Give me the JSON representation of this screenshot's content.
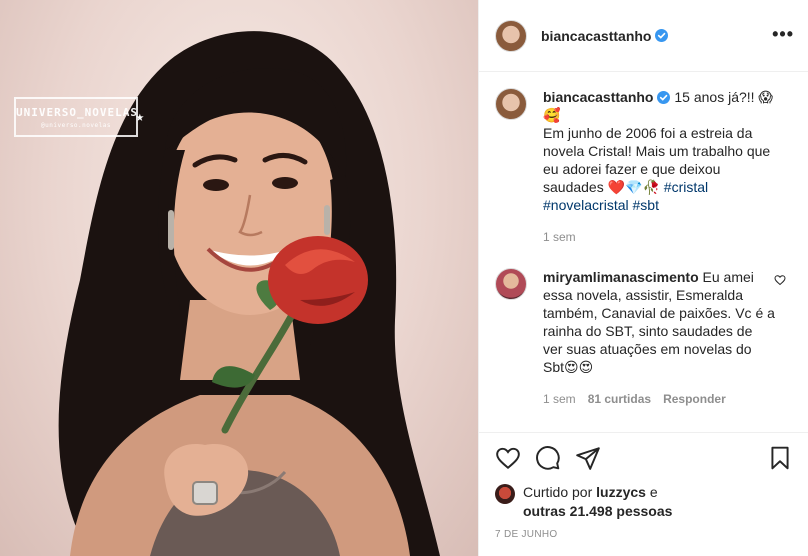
{
  "header": {
    "username": "biancacasttanho",
    "more_label": "•••"
  },
  "photo": {
    "watermark": "UNIVERSO_NOVELAS",
    "watermark_sub": "@universo.novelas"
  },
  "caption": {
    "username": "biancacasttanho",
    "text_line1": " 15 anos já?!! 😱🥰",
    "text_body": "Em junho de 2006 foi a estreia da novela Cristal! Mais um trabalho que eu adorei fazer e que deixou saudades ❤️💎🥀",
    "hashtags": [
      "#cristal",
      "#novelacristal",
      "#sbt"
    ],
    "time": "1 sem"
  },
  "comment": {
    "username": "miryamlimanascimento",
    "text": " Eu amei essa novela, assistir, Esmeralda também, Canavial de paixões. Vc é a rainha do SBT, sinto saudades de ver suas atuações em novelas do Sbt😍😍",
    "time": "1 sem",
    "likes": "81 curtidas",
    "reply": "Responder"
  },
  "likes": {
    "prefix": "Curtido por ",
    "first_user": "luzzycs",
    "middle": " e",
    "others": "outras 21.498 pessoas"
  },
  "date": "7 DE JUNHO",
  "colors": {
    "verified": "#3897f0",
    "hashtag": "#00376b",
    "muted": "#8e8e8e",
    "divider": "#efefef"
  }
}
